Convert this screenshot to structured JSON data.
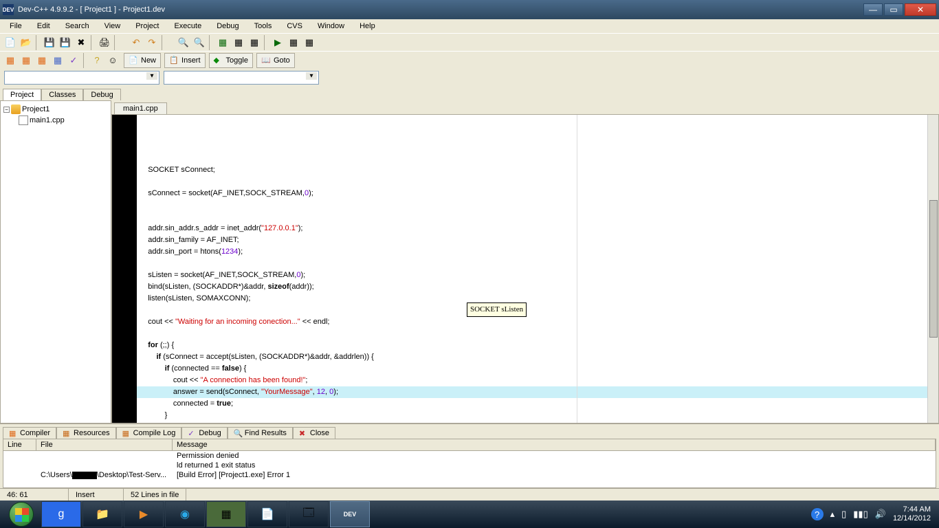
{
  "window": {
    "title": "Dev-C++ 4.9.9.2  -  [ Project1 ] - Project1.dev",
    "icon_label": "DEV"
  },
  "menus": [
    "File",
    "Edit",
    "Search",
    "View",
    "Project",
    "Execute",
    "Debug",
    "Tools",
    "CVS",
    "Window",
    "Help"
  ],
  "toolbar_buttons": {
    "new": "New",
    "insert": "Insert",
    "toggle": "Toggle",
    "goto": "Goto"
  },
  "side_tabs": [
    "Project",
    "Classes",
    "Debug"
  ],
  "project_tree": {
    "root": "Project1",
    "file": "main1.cpp"
  },
  "editor_tab": "main1.cpp",
  "tooltip": "SOCKET sListen",
  "code_lines": [
    {
      "text": "    SOCKET sConnect;",
      "tokens": [
        [
          "    SOCKET sConnect;",
          "plain"
        ]
      ]
    },
    {
      "text": "",
      "tokens": []
    },
    {
      "text": "    sConnect = socket(AF_INET,SOCK_STREAM,0);",
      "tokens": [
        [
          "    sConnect = socket(AF_INET,SOCK_STREAM,",
          "plain"
        ],
        [
          "0",
          "num"
        ],
        [
          ");",
          "plain"
        ]
      ]
    },
    {
      "text": "",
      "tokens": []
    },
    {
      "text": "",
      "tokens": []
    },
    {
      "text": "    addr.sin_addr.s_addr = inet_addr(\"127.0.0.1\");",
      "tokens": [
        [
          "    addr.sin_addr.s_addr = inet_addr(",
          "plain"
        ],
        [
          "\"127.0.0.1\"",
          "str"
        ],
        [
          ");",
          "plain"
        ]
      ]
    },
    {
      "text": "    addr.sin_family = AF_INET;",
      "tokens": [
        [
          "    addr.sin_family = AF_INET;",
          "plain"
        ]
      ]
    },
    {
      "text": "    addr.sin_port = htons(1234);",
      "tokens": [
        [
          "    addr.sin_port = htons(",
          "plain"
        ],
        [
          "1234",
          "num"
        ],
        [
          ");",
          "plain"
        ]
      ]
    },
    {
      "text": "",
      "tokens": []
    },
    {
      "text": "    sListen = socket(AF_INET,SOCK_STREAM,0);",
      "tokens": [
        [
          "    sListen = socket(AF_INET,SOCK_STREAM,",
          "plain"
        ],
        [
          "0",
          "num"
        ],
        [
          ");",
          "plain"
        ]
      ]
    },
    {
      "text": "    bind(sListen, (SOCKADDR*)&addr, sizeof(addr));",
      "tokens": [
        [
          "    bind(sListen, (SOCKADDR*)&addr, ",
          "plain"
        ],
        [
          "sizeof",
          "kw"
        ],
        [
          "(addr));",
          "plain"
        ]
      ]
    },
    {
      "text": "    listen(sListen, SOMAXCONN);",
      "tokens": [
        [
          "    listen(sListen, SOMAXCONN);",
          "plain"
        ]
      ]
    },
    {
      "text": "",
      "tokens": []
    },
    {
      "text": "    cout << \"Waiting for an incoming conection...\" << endl;",
      "tokens": [
        [
          "    cout << ",
          "plain"
        ],
        [
          "\"Waiting for an incoming conection...\"",
          "str"
        ],
        [
          " << endl;",
          "plain"
        ]
      ]
    },
    {
      "text": "",
      "tokens": []
    },
    {
      "text": "    for (;;) {",
      "tokens": [
        [
          "    ",
          "plain"
        ],
        [
          "for",
          "kw"
        ],
        [
          " (;;) {",
          "plain"
        ]
      ]
    },
    {
      "text": "        if (sConnect = accept(sListen, (SOCKADDR*)&addr, &addrlen)) {",
      "tokens": [
        [
          "        ",
          "plain"
        ],
        [
          "if",
          "kw"
        ],
        [
          " (sConnect = accept(sListen, (SOCKADDR*)&addr, &addrlen)) {",
          "plain"
        ]
      ]
    },
    {
      "text": "            if (connected == false) {",
      "tokens": [
        [
          "            ",
          "plain"
        ],
        [
          "if",
          "kw"
        ],
        [
          " (connected == ",
          "plain"
        ],
        [
          "false",
          "kw"
        ],
        [
          ") {",
          "plain"
        ]
      ]
    },
    {
      "text": "                cout << \"A connection has been found!\";",
      "tokens": [
        [
          "                cout << ",
          "plain"
        ],
        [
          "\"A connection has been found!\"",
          "str"
        ],
        [
          ";",
          "plain"
        ]
      ]
    },
    {
      "text": "                answer = send(sConnect, \"YourMessage\", 12, 0);",
      "hl": true,
      "tokens": [
        [
          "                answer = send(sConnect, ",
          "plain"
        ],
        [
          "\"YourMessage\"",
          "str"
        ],
        [
          ", ",
          "plain"
        ],
        [
          "12",
          "num"
        ],
        [
          ", ",
          "plain"
        ],
        [
          "0",
          "num"
        ],
        [
          ");",
          "plain"
        ]
      ]
    },
    {
      "text": "                connected = true;",
      "tokens": [
        [
          "                connected = ",
          "plain"
        ],
        [
          "true",
          "kw"
        ],
        [
          ";",
          "plain"
        ]
      ]
    },
    {
      "text": "            }",
      "tokens": [
        [
          "            }",
          "plain"
        ]
      ]
    },
    {
      "text": "        }",
      "tokens": [
        [
          "        }",
          "plain"
        ]
      ]
    },
    {
      "text": "    }",
      "tokens": [
        [
          "    }",
          "plain"
        ]
      ]
    },
    {
      "text": "}",
      "tokens": [
        [
          "}",
          "plain"
        ]
      ]
    }
  ],
  "output_tabs": [
    "Compiler",
    "Resources",
    "Compile Log",
    "Debug",
    "Find Results",
    "Close"
  ],
  "output_headers": {
    "line": "Line",
    "file": "File",
    "message": "Message"
  },
  "output_rows": [
    {
      "line": "",
      "file": "",
      "message": "Permission denied"
    },
    {
      "line": "",
      "file": "",
      "message": "ld returned 1 exit status"
    },
    {
      "line": "",
      "file_prefix": "C:\\Users\\",
      "file_suffix": "\\Desktop\\Test-Serv...",
      "message": "[Build Error]  [Project1.exe] Error 1"
    }
  ],
  "statusbar": {
    "cursor": "46: 61",
    "mode": "Insert",
    "lines": "52 Lines in file"
  },
  "system": {
    "time": "7:44 AM",
    "date": "12/14/2012"
  }
}
